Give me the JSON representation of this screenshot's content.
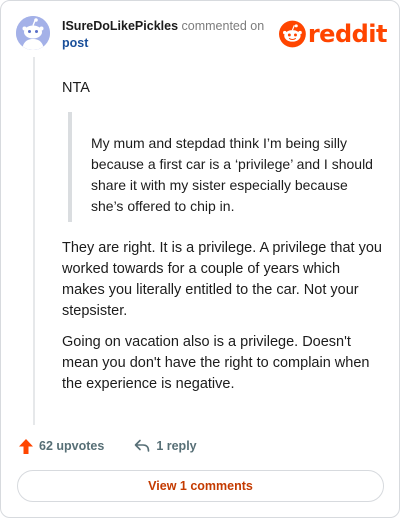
{
  "header": {
    "username": "ISureDoLikePickles",
    "action_text": "commented on",
    "post_link": "post",
    "logo_text": "reddit"
  },
  "comment": {
    "opening": "NTA",
    "quote": "My mum and stepdad think I’m being silly because a first car is a ‘privilege’ and I should share it with my sister especially because she’s offered to chip in.",
    "paragraph_1": "They are right. It is a privilege. A privilege that you worked towards for a couple of years which makes you literally entitled to the car. Not your stepsister.",
    "paragraph_2": "Going on vacation also is a privilege. Doesn't mean you don't have the right to complain when the experience is negative."
  },
  "actions": {
    "upvotes_label": "62 upvotes",
    "reply_label": "1 reply"
  },
  "footer": {
    "view_comments_label": "View 1 comments"
  },
  "colors": {
    "brand": "#ff4500",
    "link": "#1a4f9a",
    "view_button_text": "#c43a00",
    "avatar_bg": "#a4b1e8"
  },
  "icons": {
    "avatar": "snoo-avatar-icon",
    "logo": "reddit-snoo-icon",
    "upvote": "upvote-arrow-icon",
    "reply": "reply-arrow-icon"
  }
}
